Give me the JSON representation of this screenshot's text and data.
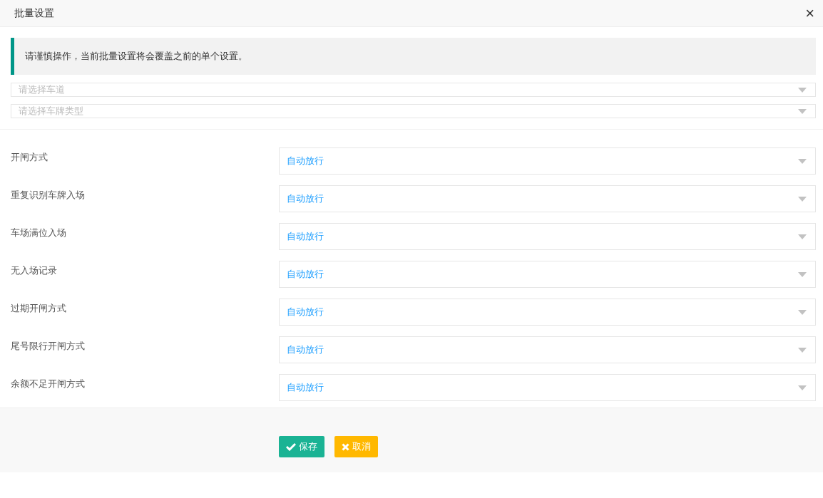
{
  "window": {
    "title": "批量设置",
    "close": "×"
  },
  "notice": "请谨慎操作，当前批量设置将会覆盖之前的单个设置。",
  "filters": [
    {
      "placeholder": "请选择车道"
    },
    {
      "placeholder": "请选择车牌类型"
    }
  ],
  "settings": [
    {
      "label": "开闸方式",
      "value": "自动放行"
    },
    {
      "label": "重复识别车牌入场",
      "value": "自动放行"
    },
    {
      "label": "车场满位入场",
      "value": "自动放行"
    },
    {
      "label": "无入场记录",
      "value": "自动放行"
    },
    {
      "label": "过期开闸方式",
      "value": "自动放行"
    },
    {
      "label": "尾号限行开闸方式",
      "value": "自动放行"
    },
    {
      "label": "余额不足开闸方式",
      "value": "自动放行"
    }
  ],
  "buttons": [
    {
      "kind": "save",
      "label": "保存"
    },
    {
      "kind": "cancel",
      "label": "取消"
    }
  ]
}
